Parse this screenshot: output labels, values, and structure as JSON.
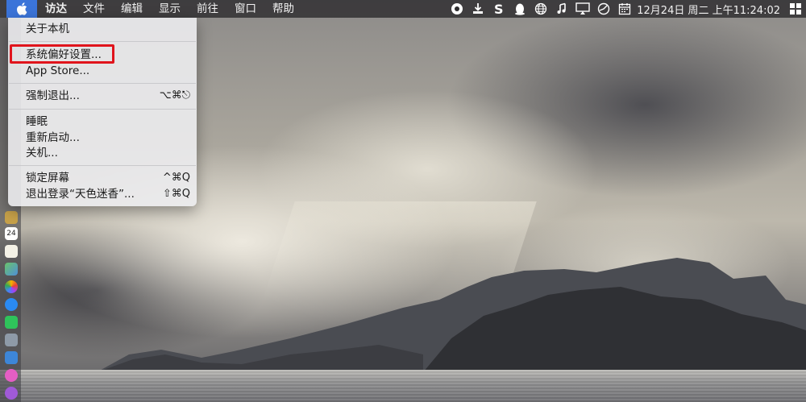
{
  "menubar": {
    "apple_icon": "apple-logo-icon",
    "items": [
      "访达",
      "文件",
      "编辑",
      "显示",
      "前往",
      "窗口",
      "帮助"
    ],
    "status_icons": [
      "baidu-netdisk-icon",
      "download-tray-icon",
      "s-app-icon",
      "qq-penguin-icon",
      "globe-icon",
      "music-note-icon",
      "airplay-display-icon",
      "timemachine-icon",
      "calendar-icon"
    ],
    "clock": "12月24日 周二 上午11:24:02",
    "trailing_icon": "windows-logo-icon"
  },
  "apple_menu": {
    "items": [
      {
        "label": "关于本机",
        "shortcut": ""
      },
      {
        "label": "系统偏好设置...",
        "shortcut": ""
      },
      {
        "label": "App Store...",
        "shortcut": ""
      },
      {
        "label": "强制退出...",
        "shortcut": "⌥⌘⎋"
      },
      {
        "label": "睡眠",
        "shortcut": ""
      },
      {
        "label": "重新启动...",
        "shortcut": ""
      },
      {
        "label": "关机...",
        "shortcut": ""
      },
      {
        "label": "锁定屏幕",
        "shortcut": "^⌘Q"
      },
      {
        "label": "退出登录“天色迷香”...",
        "shortcut": "⇧⌘Q"
      }
    ],
    "highlight_color": "#e0141c"
  },
  "dock": {
    "calendar_day": "24",
    "icons": [
      "notes-icon",
      "calendar-icon",
      "reminders-icon",
      "maps-icon",
      "photos-icon",
      "messages-icon",
      "facetime-icon",
      "system-prefs-icon",
      "keynote-icon",
      "itunes-icon",
      "podcasts-icon"
    ]
  }
}
